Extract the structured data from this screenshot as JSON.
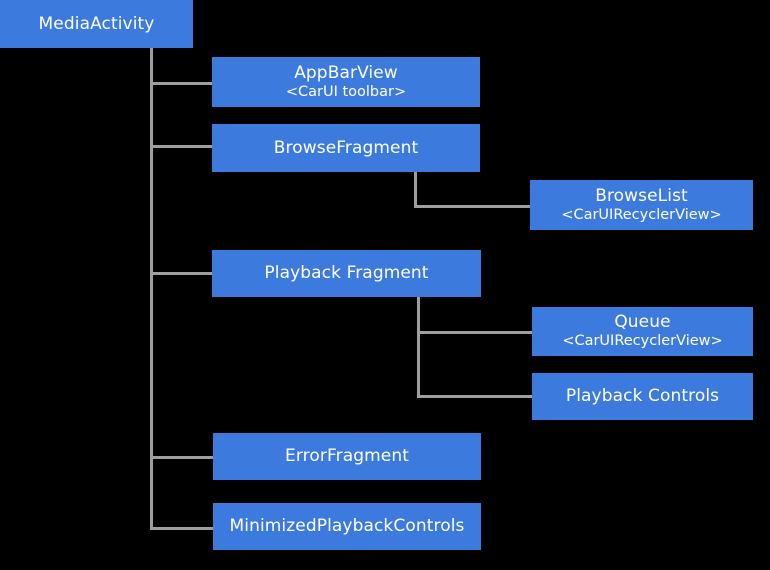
{
  "diagram": {
    "type": "hierarchy-tree",
    "background_color": "#000000",
    "node_color": "#3d7ade",
    "node_text_color": "#ffffff",
    "connector_color": "#9e9e9e",
    "root": "MediaActivity",
    "nodes": [
      {
        "id": "media-activity",
        "title": "MediaActivity",
        "subtitle": "",
        "level": 0
      },
      {
        "id": "app-bar-view",
        "title": "AppBarView",
        "subtitle": "<CarUI toolbar>",
        "level": 1
      },
      {
        "id": "browse-fragment",
        "title": "BrowseFragment",
        "subtitle": "",
        "level": 1
      },
      {
        "id": "browse-list",
        "title": "BrowseList",
        "subtitle": "<CarUIRecyclerView>",
        "level": 2
      },
      {
        "id": "playback-fragment",
        "title": "Playback Fragment",
        "subtitle": "",
        "level": 1
      },
      {
        "id": "queue",
        "title": "Queue",
        "subtitle": "<CarUIRecyclerView>",
        "level": 2
      },
      {
        "id": "playback-controls",
        "title": "Playback Controls",
        "subtitle": "",
        "level": 2
      },
      {
        "id": "error-fragment",
        "title": "ErrorFragment",
        "subtitle": "",
        "level": 1
      },
      {
        "id": "minimized-playback-controls",
        "title": "MinimizedPlaybackControls",
        "subtitle": "",
        "level": 1
      }
    ],
    "edges": [
      {
        "from": "media-activity",
        "to": "app-bar-view"
      },
      {
        "from": "media-activity",
        "to": "browse-fragment"
      },
      {
        "from": "media-activity",
        "to": "playback-fragment"
      },
      {
        "from": "media-activity",
        "to": "error-fragment"
      },
      {
        "from": "media-activity",
        "to": "minimized-playback-controls"
      },
      {
        "from": "browse-fragment",
        "to": "browse-list"
      },
      {
        "from": "playback-fragment",
        "to": "queue"
      },
      {
        "from": "playback-fragment",
        "to": "playback-controls"
      }
    ]
  }
}
